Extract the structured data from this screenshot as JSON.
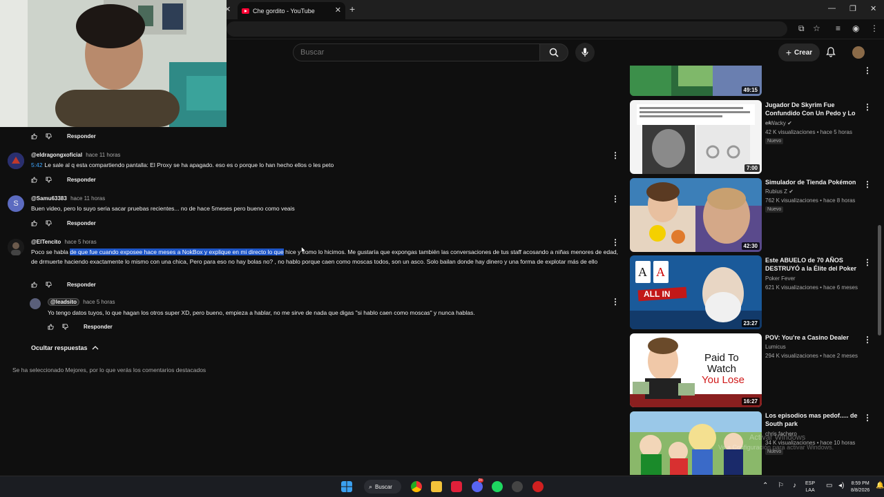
{
  "browser": {
    "tab_title": "Che gordito - YouTube",
    "new_tab_symbol": "+",
    "close_symbol": "✕"
  },
  "header": {
    "search_placeholder": "Buscar",
    "create_label": "Crear"
  },
  "comments": [
    {
      "reply_label": "Responder"
    },
    {
      "author": "@eldragongxoficial",
      "time": "hace 11 horas",
      "timestamp_link": "5:42",
      "text": "Le sale al q esta compartiendo pantalla: El Proxy se ha apagado. eso es o porque lo han hecho ellos o les peto",
      "reply_label": "Responder"
    },
    {
      "author": "@Samu63383",
      "avatar_letter": "S",
      "time": "hace 11 horas",
      "text": "Buen video, pero lo suyo seria sacar pruebas recientes... no de hace 5meses pero bueno como veais",
      "reply_label": "Responder"
    },
    {
      "author": "@ElTencito",
      "time": "hace 5 horas",
      "text_before": "Poco se habla ",
      "text_highlight": "de que fue cuando exposee hace meses a NokBox y explique en mi directo lo que",
      "text_after": " hice y como lo hicimos. Me gustaría que expongas también las conversaciones de tus staff acosando a niñas menores de edad, de drmuerte haciendo exactamente lo mismo con una chica, Pero para eso no hay bolas no? , no hablo porque caen como moscas todos, son un asco. Solo bailan donde hay dinero y una forma de explotar más de ello",
      "reply_label": "Responder"
    }
  ],
  "reply": {
    "author": "@leadsito",
    "time": "hace 5 horas",
    "text": "Yo tengo datos tuyos, lo que hagan los otros super XD, pero bueno, empieza a hablar, no me sirve de nada que digas \"si hablo caen como moscas\" y nunca hablas.",
    "reply_label": "Responder"
  },
  "hide_replies_label": "Ocultar respuestas",
  "sort_notice": "Se ha seleccionado Mejores, por lo que verás los comentarios destacados",
  "sidebar": {
    "videos": [
      {
        "duration": "49:15"
      },
      {
        "title": "Jugador De Skyrim Fue Confundido Con Un Pedo y Lo ...",
        "channel": "elWacky",
        "verified": true,
        "meta": "42 K visualizaciones • hace 5 horas",
        "badge": "Nuevo",
        "duration": "7:00"
      },
      {
        "title": "Simulador de Tienda Pokémon",
        "channel": "Rubius Z",
        "verified": true,
        "meta": "762 K visualizaciones • hace 8 horas",
        "badge": "Nuevo",
        "duration": "42:30"
      },
      {
        "title": "Este ABUELO de 70 AÑOS DESTRUYÓ a la Élite del Poker",
        "channel": "Poker Fever",
        "meta": "621 K visualizaciones • hace 6 meses",
        "duration": "23:27",
        "thumb_text": "ALL IN"
      },
      {
        "title": "POV: You're a Casino Dealer",
        "channel": "Lumicus",
        "meta": "294 K visualizaciones • hace 2 meses",
        "duration": "16:27",
        "thumb_text_1": "Paid To",
        "thumb_text_2": "Watch",
        "thumb_text_3": "You Lose"
      },
      {
        "title": "Los episodios mas pedof..... de South park",
        "channel": "chris fachero",
        "meta": "34 K visualizaciones • hace 10 horas",
        "badge": "Nuevo"
      }
    ]
  },
  "watermark": {
    "line1": "Activar Windows",
    "line2": "Ve a Configuración para activar Windows."
  },
  "taskbar": {
    "search_label": "Buscar",
    "lang_1": "ESP",
    "lang_2": "LAA",
    "time": "8:59 PM",
    "date": "8/8/2026",
    "badge_count": "9+"
  },
  "colors": {
    "background": "#0f0f0f",
    "link_blue": "#3ea6ff",
    "selection": "#1d55c7",
    "youtube_red": "#ff0033"
  }
}
